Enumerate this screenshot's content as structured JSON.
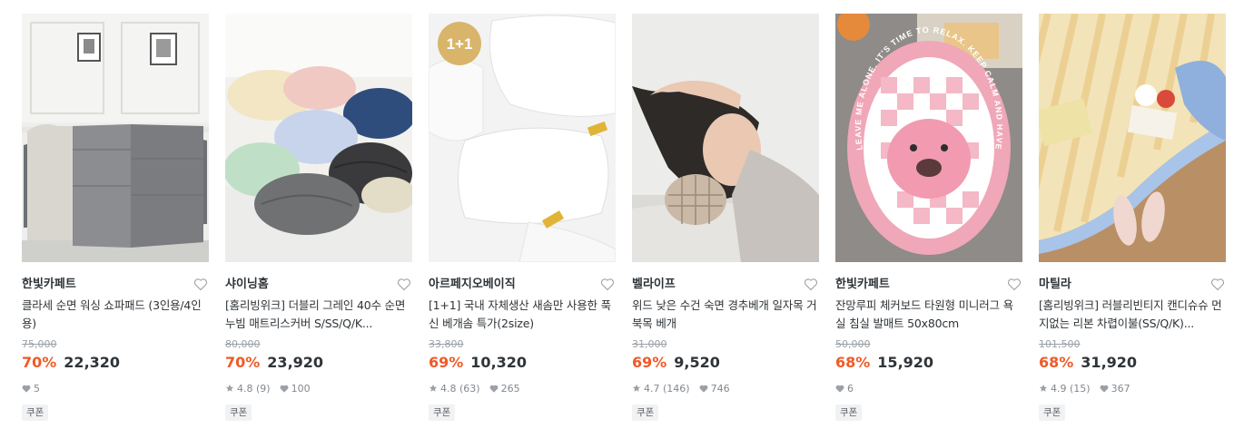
{
  "products": [
    {
      "brand": "한빛카페트",
      "title": "클라세 순면 워싱 쇼파패드 (3인용/4인용)",
      "original_price": "75,000",
      "discount": "70%",
      "price": "22,320",
      "rating": "",
      "review_count": "",
      "scrap_count": "5",
      "coupon": "쿠폰",
      "image_icon": "sofa-pad-photo"
    },
    {
      "brand": "샤이닝홈",
      "title": "[홈리빙위크] 더블리 그레인 40수 순면 누빔 매트리스커버 S/SS/Q/K...",
      "original_price": "80,000",
      "discount": "70%",
      "price": "23,920",
      "rating": "4.8",
      "review_count": "(9)",
      "scrap_count": "100",
      "coupon": "쿠폰",
      "image_icon": "mattress-cover-photo"
    },
    {
      "brand": "아르페지오베이직",
      "title": "[1+1] 국내 자체생산 새솜만 사용한 푹신 베개솜 특가(2size)",
      "original_price": "33,800",
      "discount": "69%",
      "price": "10,320",
      "rating": "4.8",
      "review_count": "(63)",
      "scrap_count": "265",
      "coupon": "쿠폰",
      "badge": "1+1",
      "image_icon": "pillow-photo"
    },
    {
      "brand": "벨라이프",
      "title": "위드 낮은 수건 숙면 경추베개 일자목 거북목 베개",
      "original_price": "31,000",
      "discount": "69%",
      "price": "9,520",
      "rating": "4.7",
      "review_count": "(146)",
      "scrap_count": "746",
      "coupon": "쿠폰",
      "image_icon": "neck-pillow-photo"
    },
    {
      "brand": "한빛카페트",
      "title": "잔망루피 체커보드 타원형 미니러그 욕실 침실 발매트 50x80cm",
      "original_price": "50,000",
      "discount": "68%",
      "price": "15,920",
      "rating": "",
      "review_count": "",
      "scrap_count": "6",
      "coupon": "쿠폰",
      "image_icon": "rug-photo",
      "rug_text": "LEAVE ME ALONE. IT'S TIME TO RELAX. KEEP CALM AND HAVE A DRINK"
    },
    {
      "brand": "마틸라",
      "title": "[홈리빙위크] 러블리빈티지 캔디슈슈 먼지없는 리본 차렵이불(SS/Q/K)...",
      "original_price": "101,500",
      "discount": "68%",
      "price": "31,920",
      "rating": "4.9",
      "review_count": "(15)",
      "scrap_count": "367",
      "coupon": "쿠폰",
      "image_icon": "comforter-photo"
    }
  ],
  "colors": {
    "discount": "#f05a28",
    "text": "#2f3438",
    "muted": "#82888f",
    "badge_gold": "#d8b56a"
  }
}
